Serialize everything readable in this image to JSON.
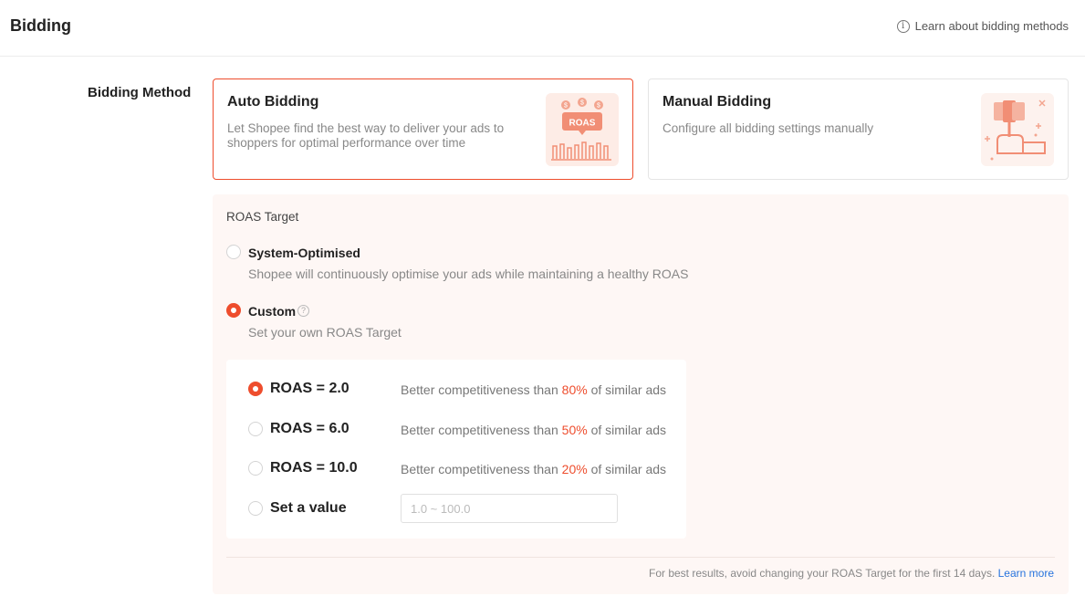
{
  "header": {
    "title": "Bidding",
    "learn_link": "Learn about bidding methods",
    "info_icon": "info-icon"
  },
  "bidding_method": {
    "label": "Bidding Method",
    "auto": {
      "title": "Auto Bidding",
      "description": "Let Shopee find the best way to deliver your ads to shoppers for optimal performance over time",
      "badge": "ROAS",
      "selected": true
    },
    "manual": {
      "title": "Manual Bidding",
      "description": "Configure all bidding settings manually",
      "selected": false
    }
  },
  "roas": {
    "label": "ROAS Target",
    "system": {
      "title": "System-Optimised",
      "description": "Shopee will continuously optimise your ads while maintaining a healthy ROAS",
      "selected": false
    },
    "custom": {
      "title": "Custom",
      "description": "Set your own ROAS Target",
      "help_icon": "question-icon",
      "selected": true
    },
    "choices": [
      {
        "label": "ROAS = 2.0",
        "prefix": "Better competitiveness than ",
        "pct": "80%",
        "suffix": " of similar ads",
        "selected": true
      },
      {
        "label": "ROAS = 6.0",
        "prefix": "Better competitiveness than ",
        "pct": "50%",
        "suffix": " of similar ads",
        "selected": false
      },
      {
        "label": "ROAS = 10.0",
        "prefix": "Better competitiveness than ",
        "pct": "20%",
        "suffix": " of similar ads",
        "selected": false
      }
    ],
    "custom_value": {
      "label": "Set a value",
      "placeholder": "1.0 ~ 100.0",
      "value": "",
      "selected": false
    },
    "footer": {
      "note": "For best results, avoid changing your ROAS Target for the first 14 days.",
      "link": "Learn more"
    }
  },
  "colors": {
    "accent": "#ee4d2d",
    "link": "#2673dd",
    "panel_bg": "#fef7f5"
  }
}
